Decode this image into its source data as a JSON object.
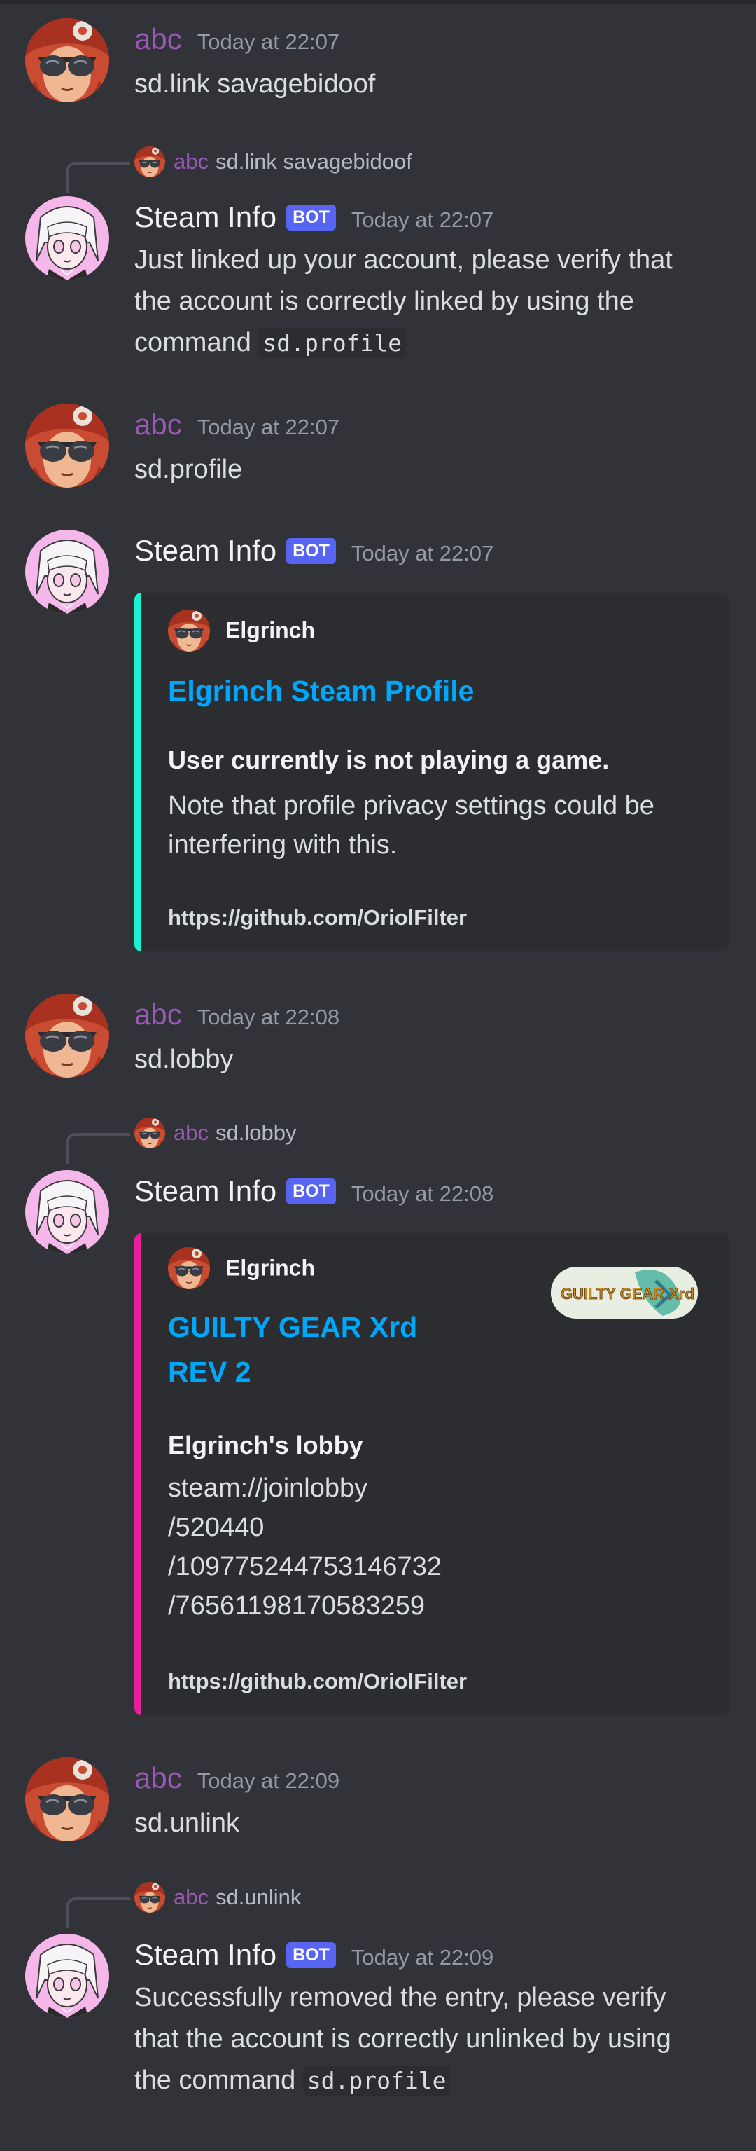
{
  "messages": [
    {
      "author": "abc",
      "time": "Today at 22:07",
      "text": "sd.link savagebidoof"
    },
    {
      "reply": {
        "author": "abc",
        "text": "sd.link savagebidoof"
      },
      "author": "Steam Info",
      "badge": "BOT",
      "time": "Today at 22:07",
      "text_lines": [
        "Just linked up your account, please verify that",
        "the account is correctly linked by using the"
      ],
      "text_prefix": "command ",
      "code": "sd.profile"
    },
    {
      "author": "abc",
      "time": "Today at 22:07",
      "text": "sd.profile"
    },
    {
      "author": "Steam Info",
      "badge": "BOT",
      "time": "Today at 22:07",
      "embed": {
        "accent": "#1bf2d4",
        "author": "Elgrinch",
        "title": "Elgrinch Steam Profile",
        "field_name": "User currently is not playing a game.",
        "field_value": "Note that profile privacy settings could be\ninterfering with this.",
        "footer": "https://github.com/OriolFilter"
      }
    },
    {
      "author": "abc",
      "time": "Today at 22:08",
      "text": "sd.lobby"
    },
    {
      "reply": {
        "author": "abc",
        "text": "sd.lobby"
      },
      "author": "Steam Info",
      "badge": "BOT",
      "time": "Today at 22:08",
      "embed": {
        "accent": "#e91e9c",
        "author": "Elgrinch",
        "title": "GUILTY GEAR Xrd\nREV 2",
        "thumbnail_text": "GUILTY GEAR Xrd",
        "field_name": "Elgrinch's lobby",
        "field_value": "steam://joinlobby\n/520440\n/109775244753146732\n/76561198170583259",
        "footer": "https://github.com/OriolFilter"
      }
    },
    {
      "author": "abc",
      "time": "Today at 22:09",
      "text": "sd.unlink"
    },
    {
      "reply": {
        "author": "abc",
        "text": "sd.unlink"
      },
      "author": "Steam Info",
      "badge": "BOT",
      "time": "Today at 22:09",
      "text_lines": [
        "Successfully removed the entry, please verify",
        "that the account is correctly unlinked by using"
      ],
      "text_prefix": "the command ",
      "code": "sd.profile"
    }
  ],
  "colors": {
    "background": "#313338",
    "user_name": "#9b59b6",
    "link": "#00a8fc",
    "badge": "#5865f2"
  },
  "icons": {
    "user_avatar": "red-haired-anime-avatar",
    "bot_avatar": "pink-anime-avatar"
  }
}
